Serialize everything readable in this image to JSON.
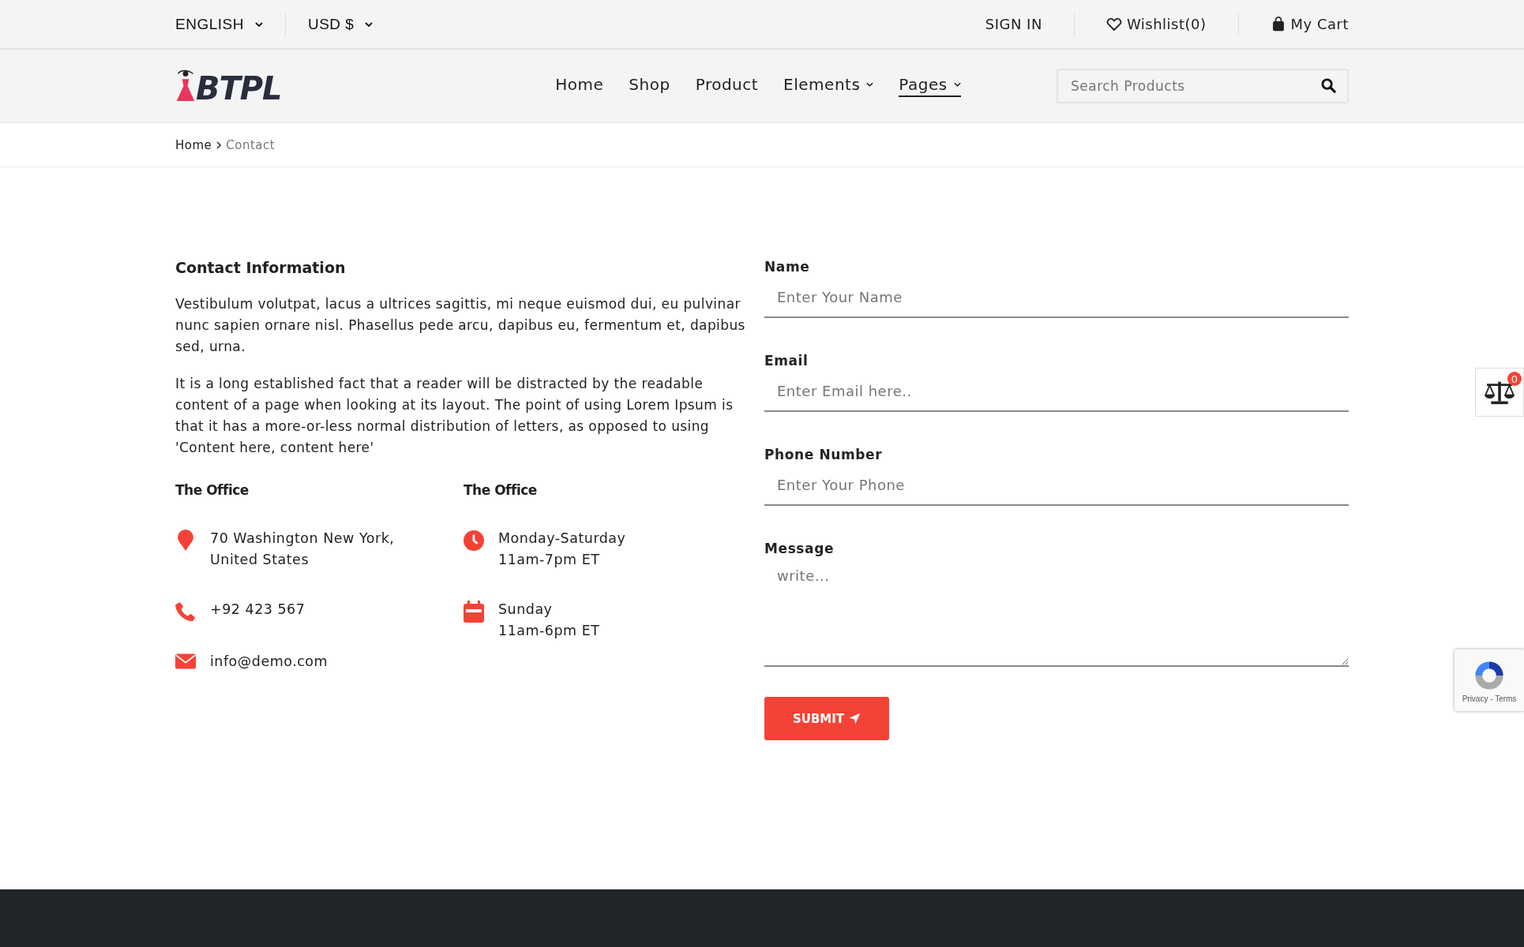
{
  "top_bar": {
    "language": "ENGLISH",
    "currency": "USD $",
    "sign_in": "SIGN IN",
    "wishlist": "Wishlist(0)",
    "cart": "My Cart"
  },
  "header": {
    "logo": "BTPL",
    "nav": [
      {
        "label": "Home",
        "selected": false,
        "has_menu": false
      },
      {
        "label": "Shop",
        "selected": false,
        "has_menu": false
      },
      {
        "label": "Product",
        "selected": false,
        "has_menu": false
      },
      {
        "label": "Elements",
        "selected": false,
        "has_menu": true
      },
      {
        "label": "Pages",
        "selected": true,
        "has_menu": true
      }
    ],
    "search": {
      "placeholder": "Search Products"
    }
  },
  "breadcrumb": [
    {
      "label": "Home",
      "current": false
    },
    {
      "label": "Contact",
      "current": true
    }
  ],
  "contact": {
    "title": "Contact Information",
    "paragraphs": [
      "Vestibulum volutpat, lacus a ultrices sagittis, mi neque euismod dui, eu pulvinar nunc sapien ornare nisl. Phasellus pede arcu, dapibus eu, fermentum et, dapibus sed, urna.",
      "It is a long established fact that a reader will be distracted by the readable content of a page when looking at its layout. The point of using Lorem Ipsum is that it has a more-or-less normal distribution of letters, as opposed to using 'Content here, content here'"
    ],
    "columns": [
      {
        "title": "The Office",
        "items": [
          {
            "kind": "pin",
            "lines": [
              "70 Washington New York,",
              "United States"
            ]
          },
          {
            "kind": "phone",
            "lines": [
              "+92 423 567"
            ]
          },
          {
            "kind": "mail",
            "lines": [
              "info@demo.com"
            ]
          }
        ]
      },
      {
        "title": "The Office",
        "items": [
          {
            "kind": "clock",
            "lines": [
              "Monday-Saturday",
              "11am-7pm ET"
            ]
          },
          {
            "kind": "calendar",
            "lines": [
              "Sunday",
              "11am-6pm ET"
            ]
          }
        ]
      }
    ]
  },
  "form": {
    "fields": [
      {
        "kind": "input",
        "label": "Name",
        "placeholder": "Enter Your Name"
      },
      {
        "kind": "input",
        "label": "Email",
        "placeholder": "Enter Email here.."
      },
      {
        "kind": "input",
        "label": "Phone Number",
        "placeholder": "Enter Your Phone"
      },
      {
        "kind": "textarea",
        "label": "Message",
        "placeholder": "write..."
      }
    ],
    "submit": "SUBMIT"
  },
  "compare": {
    "count": "0"
  },
  "recaptcha": {
    "links": "Privacy - Terms"
  }
}
